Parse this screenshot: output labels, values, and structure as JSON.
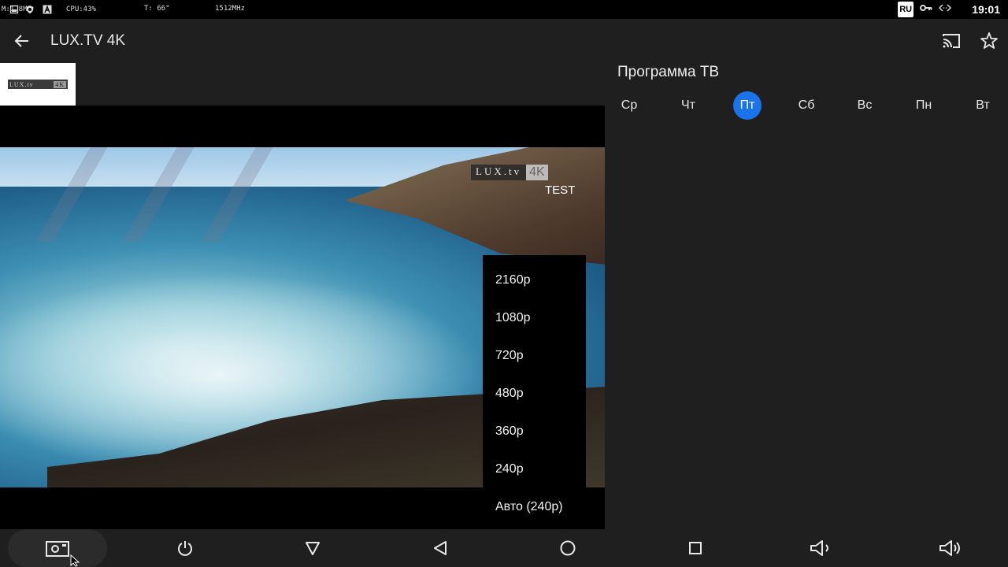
{
  "status_bar": {
    "mem_text": "M:1.8MB",
    "cpu_text": "CPU:43%",
    "temp_text": "T: 66°",
    "freq_text": "1512MHz",
    "lang_badge": "RU",
    "clock": "19:01",
    "icons": [
      "sd-card-icon",
      "shield-icon",
      "a-letter-icon",
      "vpn-key-icon",
      "code-arrows-icon"
    ]
  },
  "app_bar": {
    "title": "LUX.TV 4K",
    "icons": [
      "back-arrow-icon",
      "cast-icon",
      "star-icon"
    ]
  },
  "channel_logo": {
    "text_lux": "LUX.tv",
    "text_4k": "4K"
  },
  "video": {
    "watermark_lux": "LUX.tv",
    "watermark_4k": "4K",
    "watermark_test": "TEST"
  },
  "quality_menu": {
    "options": [
      "2160p",
      "1080p",
      "720p",
      "480p",
      "360p",
      "240p",
      "Авто (240p)"
    ]
  },
  "program_guide": {
    "title": "Программа ТВ",
    "days": [
      "Ср",
      "Чт",
      "Пт",
      "Сб",
      "Вс",
      "Пн",
      "Вт"
    ],
    "selected_day": "Пт",
    "accent_color": "#1a73e8"
  },
  "nav_bar": {
    "icons": [
      "screenshot-icon",
      "power-icon",
      "dropdown-triangle-icon",
      "back-triangle-icon",
      "home-circle-icon",
      "recents-square-icon",
      "volume-down-icon",
      "volume-up-icon"
    ]
  }
}
